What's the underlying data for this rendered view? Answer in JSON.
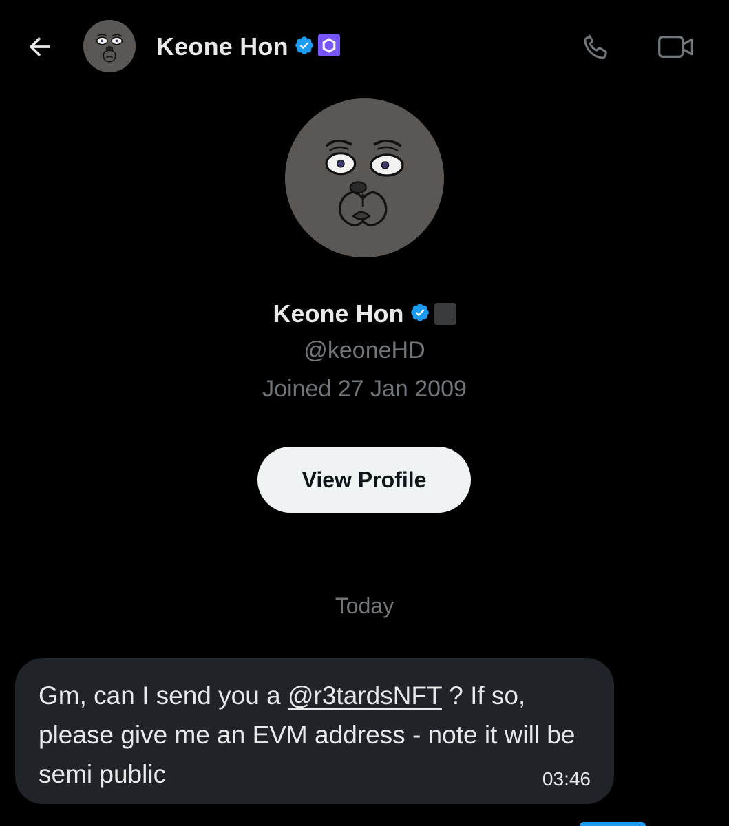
{
  "header": {
    "back_icon": "arrow-left-icon",
    "name": "Keone Hon",
    "verified_icon": "verified-badge-icon",
    "affiliate_icon": "affiliate-badge-icon",
    "call_icon": "phone-icon",
    "video_icon": "video-camera-icon"
  },
  "profile": {
    "name": "Keone Hon",
    "handle": "@keoneHD",
    "joined": "Joined 27 Jan 2009",
    "view_profile_label": "View Profile"
  },
  "conversation": {
    "date_divider": "Today",
    "messages": [
      {
        "text_before": "Gm, can I send you a ",
        "mention": "@r3tardsNFT",
        "text_after": " ? If so, please give me an EVM address - note it will be semi public",
        "time": "03:46"
      }
    ]
  },
  "colors": {
    "background": "#000000",
    "text_primary": "#e7e9ea",
    "text_secondary": "#71767b",
    "verified_blue": "#1d9bf0",
    "affiliate_purple": "#7856ff",
    "bubble_bg": "#202327",
    "button_bg": "#eff3f4"
  }
}
